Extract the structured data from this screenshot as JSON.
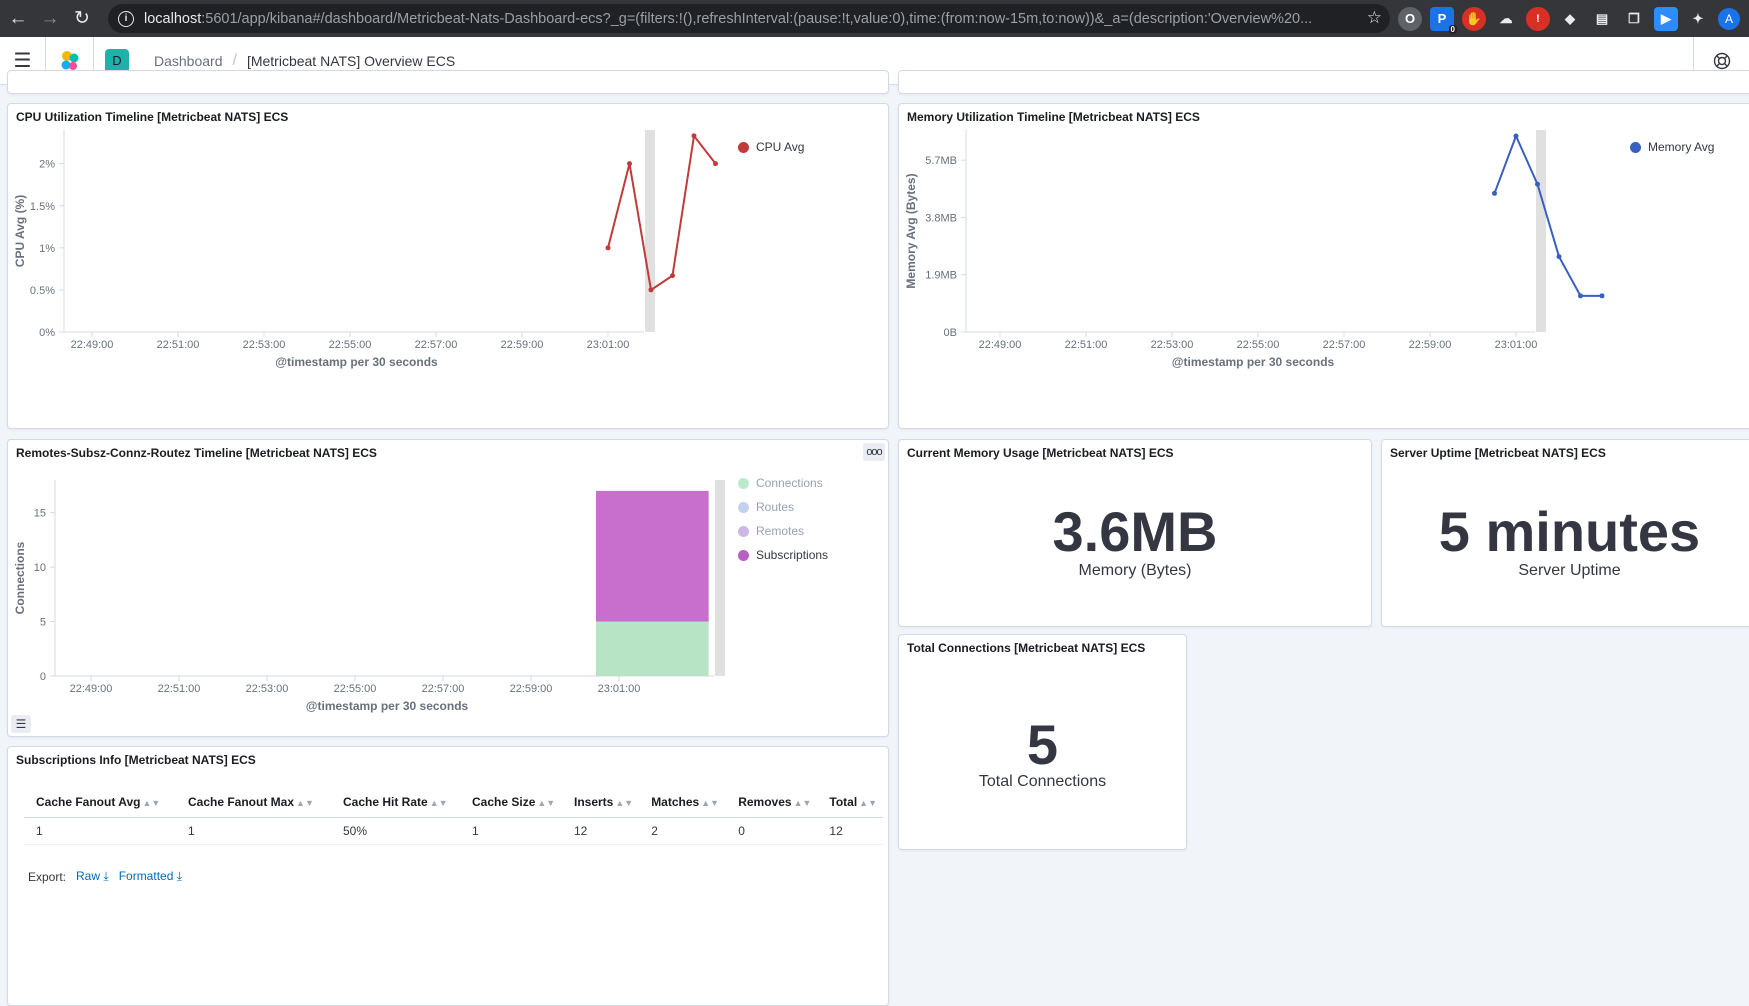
{
  "browser": {
    "url_host": "localhost",
    "url_rest": ":5601/app/kibana#/dashboard/Metricbeat-Nats-Dashboard-ecs?_g=(filters:!(),refreshInterval:(pause:!t,value:0),time:(from:now-15m,to:now))&_a=(description:'Overview%20...",
    "ext_badge": "0",
    "avatar_letter": "A"
  },
  "header": {
    "space_letter": "D",
    "breadcrumb_root": "Dashboard",
    "breadcrumb_current": "[Metricbeat NATS] Overview ECS"
  },
  "cpu_panel": {
    "title": "CPU Utilization Timeline [Metricbeat NATS] ECS",
    "legend": [
      {
        "label": "CPU Avg",
        "color": "#c13a3a"
      }
    ]
  },
  "memory_panel": {
    "title": "Memory Utilization Timeline [Metricbeat NATS] ECS",
    "legend": [
      {
        "label": "Memory Avg",
        "color": "#3860bf"
      }
    ]
  },
  "remotes_panel": {
    "title": "Remotes-Subsz-Connz-Routez Timeline [Metricbeat NATS] ECS",
    "options_icon": "ooo",
    "legend_toggle_icon": "☰",
    "legend": [
      {
        "label": "Connections",
        "color": "#b6e4c5",
        "faded": true
      },
      {
        "label": "Routes",
        "color": "#7b9ae0",
        "faded": true
      },
      {
        "label": "Remotes",
        "color": "#8e61c9",
        "faded": true
      },
      {
        "label": "Subscriptions",
        "color": "#b85fc4",
        "faded": false
      }
    ]
  },
  "memory_usage_panel": {
    "title": "Current Memory Usage [Metricbeat NATS] ECS",
    "value": "3.6MB",
    "label": "Memory (Bytes)"
  },
  "uptime_panel": {
    "title": "Server Uptime [Metricbeat NATS] ECS",
    "value": "5 minutes",
    "label": "Server Uptime"
  },
  "connections_panel": {
    "title": "Total Connections [Metricbeat NATS] ECS",
    "value": "5",
    "label": "Total Connections"
  },
  "subs_panel": {
    "title": "Subscriptions Info [Metricbeat NATS] ECS",
    "columns": [
      "Cache Fanout Avg",
      "Cache Fanout Max",
      "Cache Hit Rate",
      "Cache Size",
      "Inserts",
      "Matches",
      "Removes",
      "Total"
    ],
    "rows": [
      [
        "1",
        "1",
        "50%",
        "1",
        "12",
        "2",
        "0",
        "12"
      ]
    ],
    "export_label": "Export:",
    "export_raw": "Raw",
    "export_formatted": "Formatted"
  },
  "chart_data": [
    {
      "type": "line",
      "title": "CPU Utilization Timeline [Metricbeat NATS] ECS",
      "xlabel": "@timestamp per 30 seconds",
      "ylabel": "CPU Avg (%)",
      "x_ticks": [
        "22:49:00",
        "22:51:00",
        "22:53:00",
        "22:55:00",
        "22:57:00",
        "22:59:00",
        "23:01:00"
      ],
      "y_ticks": [
        "0%",
        "0.5%",
        "1%",
        "1.5%",
        "2%"
      ],
      "ylim": [
        0,
        2.4
      ],
      "series": [
        {
          "name": "CPU Avg",
          "color": "#c13a3a",
          "x": [
            "23:01:00",
            "23:01:30",
            "23:02:00",
            "23:02:30",
            "23:03:00",
            "23:03:30"
          ],
          "values": [
            1.0,
            2.0,
            0.5,
            0.67,
            2.33,
            2.0
          ]
        }
      ]
    },
    {
      "type": "line",
      "title": "Memory Utilization Timeline [Metricbeat NATS] ECS",
      "xlabel": "@timestamp per 30 seconds",
      "ylabel": "Memory Avg (Bytes)",
      "x_ticks": [
        "22:49:00",
        "22:51:00",
        "22:53:00",
        "22:55:00",
        "22:57:00",
        "22:59:00",
        "23:01:00"
      ],
      "y_ticks": [
        "0B",
        "1.9MB",
        "3.8MB",
        "5.7MB"
      ],
      "ylim": [
        0,
        6.7
      ],
      "series": [
        {
          "name": "Memory Avg",
          "color": "#3860bf",
          "x": [
            "23:00:30",
            "23:01:00",
            "23:01:30",
            "23:02:00",
            "23:02:30",
            "23:03:00"
          ],
          "values": [
            4.6,
            6.5,
            4.9,
            2.5,
            1.2,
            1.2
          ]
        }
      ]
    },
    {
      "type": "bar",
      "title": "Remotes-Subsz-Connz-Routez Timeline [Metricbeat NATS] ECS",
      "xlabel": "@timestamp per 30 seconds",
      "ylabel": "Connections",
      "x_ticks": [
        "22:49:00",
        "22:51:00",
        "22:53:00",
        "22:55:00",
        "22:57:00",
        "22:59:00",
        "23:01:00"
      ],
      "y_ticks": [
        "0",
        "5",
        "10",
        "15"
      ],
      "ylim": [
        0,
        18
      ],
      "stacked": true,
      "series": [
        {
          "name": "Connections",
          "color": "#b6e4c5",
          "x": [
            "23:01:00"
          ],
          "values": [
            5
          ]
        },
        {
          "name": "Subscriptions",
          "color": "#c86fce",
          "x": [
            "23:01:00"
          ],
          "values": [
            12
          ]
        }
      ]
    }
  ]
}
